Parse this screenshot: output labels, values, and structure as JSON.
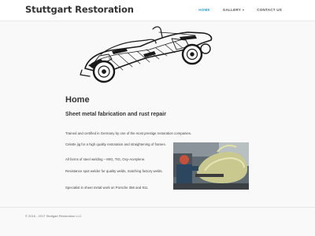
{
  "site": {
    "title": "Stuttgart Restoration"
  },
  "nav": {
    "items": [
      {
        "label": "HOME",
        "active": true
      },
      {
        "label": "GALLERY",
        "has_dropdown": true
      },
      {
        "label": "CONTACT US"
      }
    ]
  },
  "main": {
    "title": "Home",
    "subtitle": "Sheet metal fabrication and rust repair",
    "paragraphs": [
      "Trained and certified in Germany by one of the most prestige restoration companies.",
      "Celette jig for a high quality restoration and straightening of frames.",
      "All forms of steel welding – MIG, TIG, Oxy-Acetylene.",
      "Resistance spot welder for quality welds, matching factory welds.",
      "Specialist in sheet metal work on Porsche 356 and 911."
    ]
  },
  "footer": {
    "copyright": "© 2016 - 2017 Stuttgart Restoration LLC"
  },
  "icons": {
    "gallery_dropdown": "chevron-down-icon"
  },
  "colors": {
    "accent": "#2e9fd6",
    "background": "#f9f9f9",
    "header": "#ffffff"
  }
}
